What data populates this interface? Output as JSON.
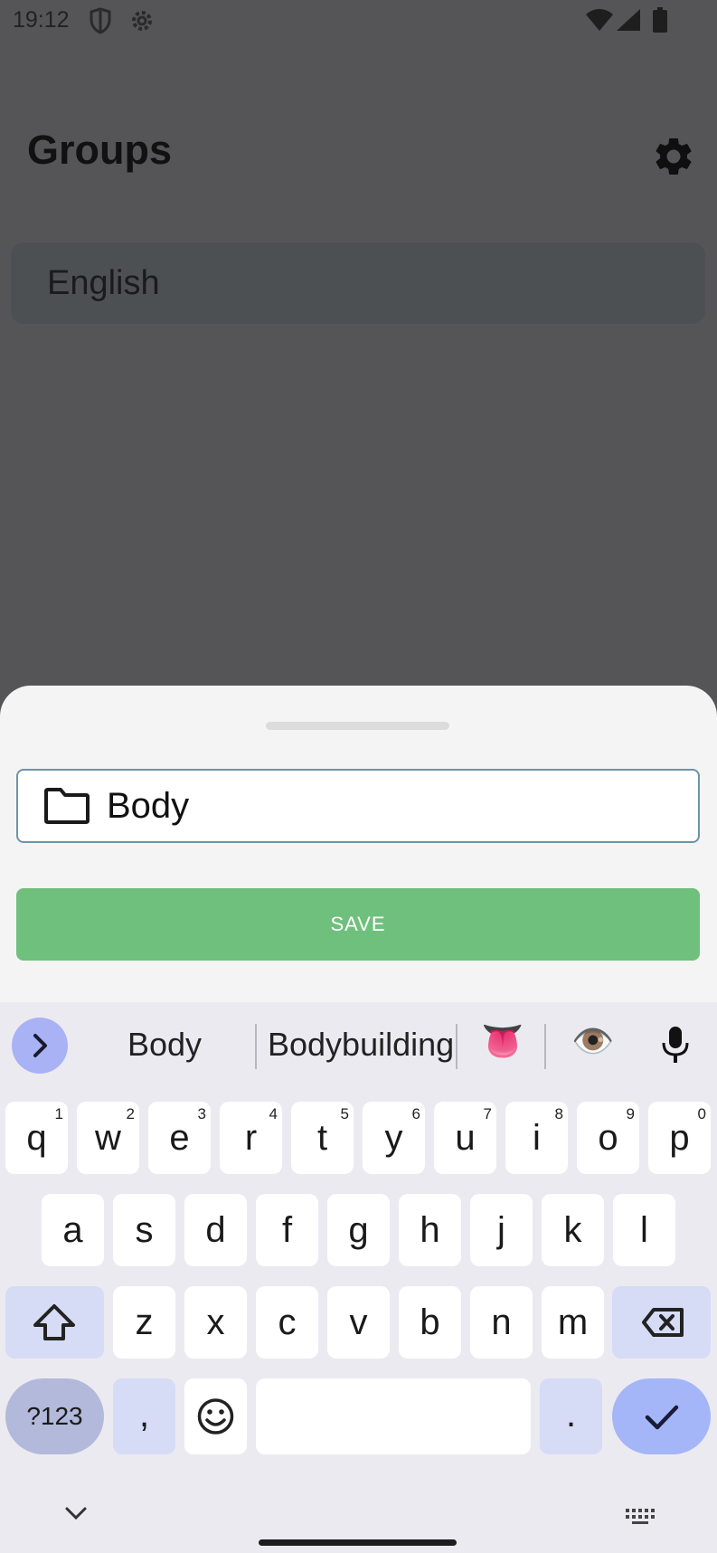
{
  "status_bar": {
    "time": "19:12"
  },
  "app": {
    "title": "Groups",
    "groups": [
      {
        "label": "English"
      }
    ]
  },
  "sheet": {
    "name_value": "Body",
    "save_label": "SAVE"
  },
  "keyboard": {
    "suggestions": [
      "Body",
      "Bodybuilding"
    ],
    "emoji_suggestions": [
      "👅",
      "👁️"
    ],
    "row1": [
      {
        "ch": "q",
        "hint": "1"
      },
      {
        "ch": "w",
        "hint": "2"
      },
      {
        "ch": "e",
        "hint": "3"
      },
      {
        "ch": "r",
        "hint": "4"
      },
      {
        "ch": "t",
        "hint": "5"
      },
      {
        "ch": "y",
        "hint": "6"
      },
      {
        "ch": "u",
        "hint": "7"
      },
      {
        "ch": "i",
        "hint": "8"
      },
      {
        "ch": "o",
        "hint": "9"
      },
      {
        "ch": "p",
        "hint": "0"
      }
    ],
    "row2": [
      "a",
      "s",
      "d",
      "f",
      "g",
      "h",
      "j",
      "k",
      "l"
    ],
    "row3": [
      "z",
      "x",
      "c",
      "v",
      "b",
      "n",
      "m"
    ],
    "symbols_label": "?123",
    "comma_label": ",",
    "period_label": "."
  },
  "colors": {
    "accent_green": "#6fc07c",
    "field_border": "#6c94a8",
    "keyboard_accent": "#a4b6f7"
  }
}
